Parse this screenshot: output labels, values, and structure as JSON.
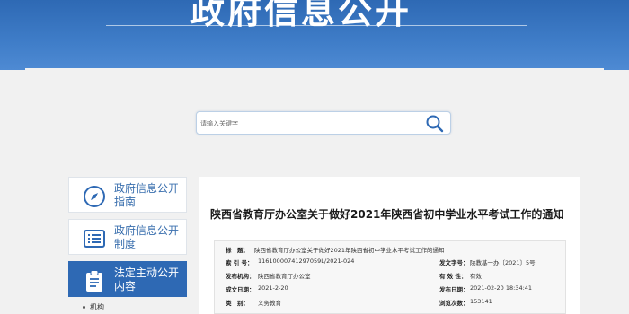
{
  "banner": {
    "title": "政府信息公开"
  },
  "search": {
    "placeholder": "请输入关键字"
  },
  "sidebar": {
    "items": [
      {
        "label": "政府信息公开指南",
        "icon": "compass-icon",
        "active": false
      },
      {
        "label": "政府信息公开制度",
        "icon": "list-icon",
        "active": false
      },
      {
        "label": "法定主动公开内容",
        "icon": "clipboard-icon",
        "active": true
      }
    ],
    "sub_items": [
      {
        "label": "机构"
      }
    ]
  },
  "document": {
    "title": "陕西省教育厅办公室关于做好2021年陕西省初中学业水平考试工作的通知",
    "meta": {
      "title_key": "标　题：",
      "title_value": "陕西省教育厅办公室关于做好2021年陕西省初中学业水平考试工作的通知",
      "index_key": "索 引 号：",
      "index_value": "11610000741297059L/2021-024",
      "doc_no_key": "发文字号：",
      "doc_no_value": "陕教基一办〔2021〕5号",
      "issuer_key": "发布机构：",
      "issuer_value": "陕西省教育厅办公室",
      "validity_key": "有 效 性：",
      "validity_value": "有效",
      "created_key": "成文日期：",
      "created_value": "2021-2-20",
      "published_key": "发布日期：",
      "published_value": "2021-02-20 18:34:41",
      "category_key": "类　别：",
      "category_value": "义务教育",
      "views_key": "浏览次数：",
      "views_value": "153141"
    }
  },
  "colors": {
    "brand": "#2e69b4",
    "link": "#3a6fae"
  }
}
